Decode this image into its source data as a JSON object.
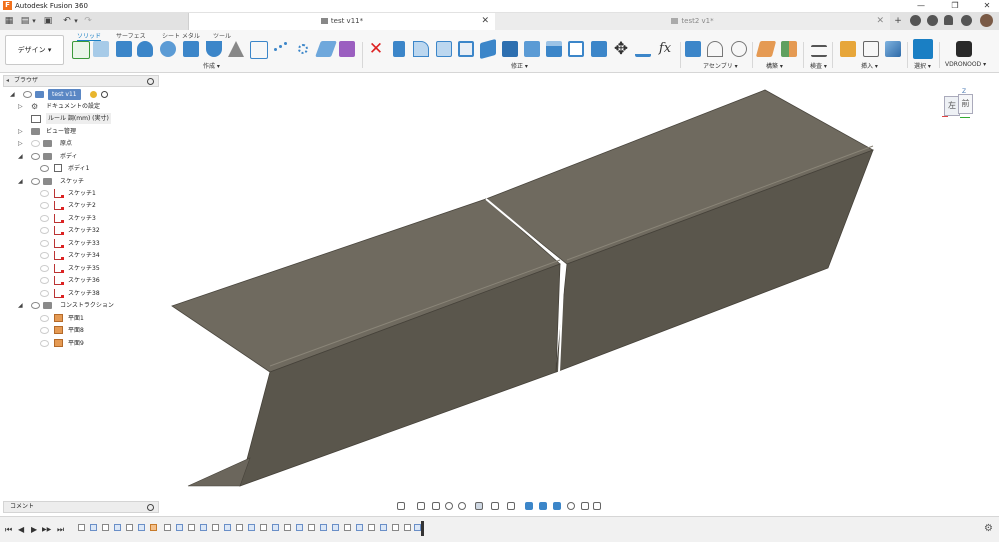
{
  "window": {
    "app_title": "Autodesk Fusion 360",
    "minimize": "—",
    "maximize": "❐",
    "close": "✕"
  },
  "tabs": {
    "active_title": "test v11*",
    "inactive_title": "test2 v1*",
    "close_glyph": "✕",
    "new_tab_glyph": "+"
  },
  "quick_access": {
    "grid": "▦",
    "file": "▤",
    "save": "▣",
    "undo": "↶",
    "redo": "↷",
    "dropdown": "▾"
  },
  "ribbon": {
    "workspace_label": "デザイン ▾",
    "ribbon_tabs": [
      "ソリッド",
      "サーフェス",
      "シート メタル",
      "ツール"
    ],
    "groups": [
      "作成 ▾",
      "修正 ▾",
      "アセンブリ ▾",
      "構築 ▾",
      "検査 ▾",
      "挿入 ▾",
      "選択 ▾",
      "VDRONOOD ▾"
    ]
  },
  "browser": {
    "title": "ブラウザ",
    "items": [
      {
        "label": "test v11",
        "kind": "root"
      },
      {
        "label": "ドキュメントの設定",
        "kind": "settings"
      },
      {
        "label": "ルール 調(mm) (実寸)",
        "kind": "units"
      },
      {
        "label": "ビュー管理",
        "kind": "folder"
      },
      {
        "label": "原点",
        "kind": "folder"
      },
      {
        "label": "ボディ",
        "kind": "folder"
      },
      {
        "label": "ボディ1",
        "kind": "body"
      },
      {
        "label": "スケッチ",
        "kind": "folder"
      },
      {
        "label": "スケッチ1",
        "kind": "sketch"
      },
      {
        "label": "スケッチ2",
        "kind": "sketch"
      },
      {
        "label": "スケッチ3",
        "kind": "sketch"
      },
      {
        "label": "スケッチ32",
        "kind": "sketch"
      },
      {
        "label": "スケッチ33",
        "kind": "sketch"
      },
      {
        "label": "スケッチ34",
        "kind": "sketch"
      },
      {
        "label": "スケッチ35",
        "kind": "sketch"
      },
      {
        "label": "スケッチ36",
        "kind": "sketch"
      },
      {
        "label": "スケッチ38",
        "kind": "sketch"
      },
      {
        "label": "コンストラクション",
        "kind": "folder"
      },
      {
        "label": "平面1",
        "kind": "plane"
      },
      {
        "label": "平面8",
        "kind": "plane"
      },
      {
        "label": "平面9",
        "kind": "plane"
      }
    ]
  },
  "comments": {
    "title": "コメント"
  },
  "viewcube": {
    "left_face": "左",
    "front_face": "前",
    "z_axis": "Z"
  },
  "timeline": {
    "controls": [
      "⏮",
      "◀",
      "▶",
      "▶▶",
      "⏭"
    ]
  }
}
